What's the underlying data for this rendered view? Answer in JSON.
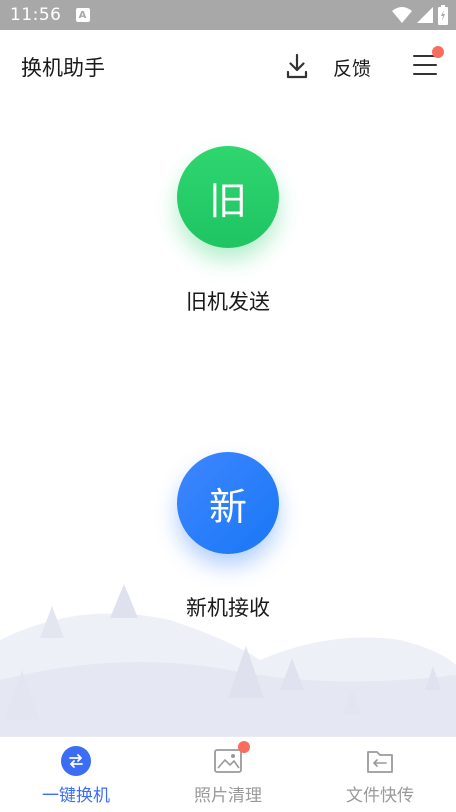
{
  "status_bar": {
    "time": "11:56",
    "notification_badge": "A"
  },
  "header": {
    "title": "换机助手",
    "download_icon": "download-icon",
    "feedback_label": "反馈",
    "menu_icon": "hamburger-menu-icon",
    "menu_has_badge": true
  },
  "actions": [
    {
      "glyph": "旧",
      "label": "旧机发送",
      "color": "#22cc66"
    },
    {
      "glyph": "新",
      "label": "新机接收",
      "color": "#2b7ef8"
    }
  ],
  "bottom_nav": {
    "items": [
      {
        "label": "一键换机",
        "icon": "swap-arrows-icon",
        "active": true
      },
      {
        "label": "照片清理",
        "icon": "photo-icon",
        "active": false,
        "badge": true
      },
      {
        "label": "文件快传",
        "icon": "folder-transfer-icon",
        "active": false
      }
    ]
  },
  "colors": {
    "accent": "#3c6ef5",
    "green": "#22cc66",
    "blue": "#2b7ef8",
    "badge": "#fa6c5c",
    "status_bar": "#a8a8a8"
  }
}
